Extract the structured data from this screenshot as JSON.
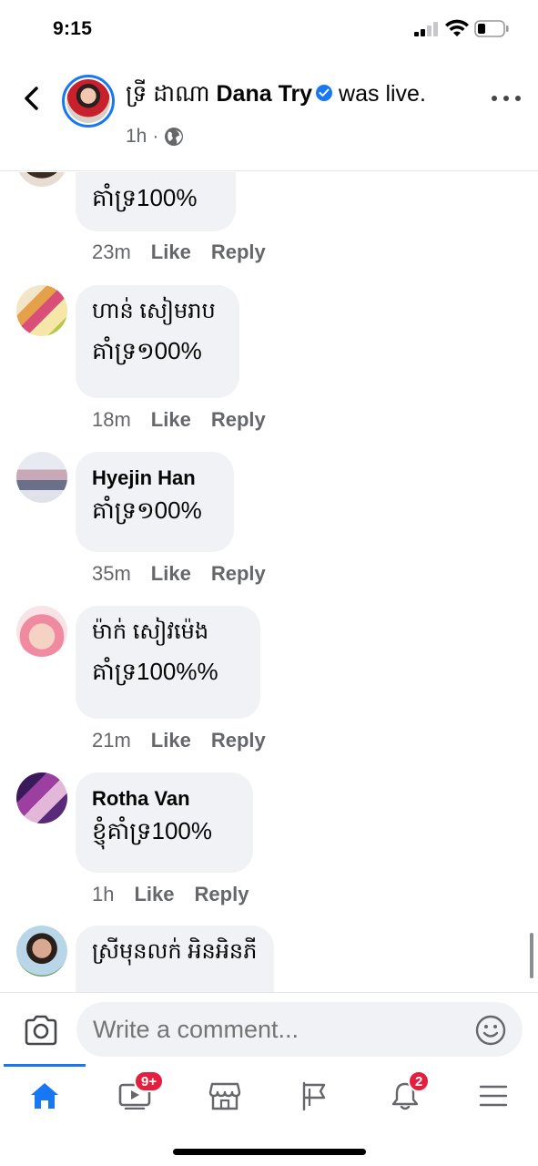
{
  "status": {
    "time": "9:15"
  },
  "header": {
    "name_kh": "ទ្រី ដាណា",
    "name_en": "Dana Try",
    "action": "was live.",
    "time": "1h",
    "dot": "·"
  },
  "comments": [
    {
      "author": "",
      "text": "គាំទ្រ100%",
      "time": "23m",
      "like": "Like",
      "reply": "Reply"
    },
    {
      "author": "ហាន់ សៀមរាប",
      "text": "គាំទ្រ១00%",
      "time": "18m",
      "like": "Like",
      "reply": "Reply"
    },
    {
      "author": "Hyejin Han",
      "text": "គាំទ្រ១00%",
      "time": "35m",
      "like": "Like",
      "reply": "Reply"
    },
    {
      "author": "ម៉ាក់ សៀវម៉េង",
      "text": "គាំទ្រ100%%",
      "time": "21m",
      "like": "Like",
      "reply": "Reply"
    },
    {
      "author": "Rotha Van",
      "text": "ខ្ញុំគាំទ្រ100%",
      "time": "1h",
      "like": "Like",
      "reply": "Reply"
    },
    {
      "author": "ស្រីមុនលក់ អិនអិនភី",
      "text": "",
      "time": "",
      "like": "",
      "reply": ""
    }
  ],
  "composer": {
    "placeholder": "Write a comment..."
  },
  "tabs": {
    "home": "home-icon",
    "watch_badge": "9+",
    "marketplace": "marketplace-icon",
    "pages": "flag-icon",
    "notifications_badge": "2",
    "menu": "menu-icon"
  },
  "colors": {
    "accent": "#1877f2",
    "badge": "#e41e3f",
    "bubble": "#f0f2f5",
    "meta": "#65676b"
  }
}
